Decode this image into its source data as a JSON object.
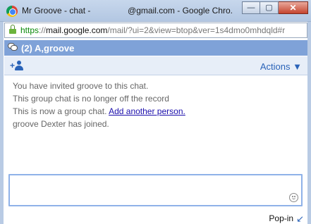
{
  "window": {
    "title_prefix": "Mr Groove - chat -",
    "title_suffix": "@gmail.com - Google Chro...",
    "minimize_glyph": "—",
    "maximize_glyph": "▢",
    "close_glyph": "✕"
  },
  "urlbar": {
    "scheme": "https",
    "separator": "://",
    "host": "mail.google.com",
    "path": "/mail/?ui=2&view=btop&ver=1s4dmo0mhdqld#r"
  },
  "chat": {
    "title": "(2) A,groove",
    "actions_label": "Actions ▼",
    "add_person_plus": "+"
  },
  "messages": [
    {
      "text": "You have invited groove to this chat."
    },
    {
      "text": "This group chat is no longer off the record"
    },
    {
      "text": "This is now a group chat.",
      "link": "Add another person."
    },
    {
      "text": "groove Dexter has joined."
    }
  ],
  "input": {
    "value": "",
    "placeholder": ""
  },
  "footer": {
    "popin_label": "Pop-in",
    "popin_arrow": "↙"
  },
  "colors": {
    "header_bg": "#7fa2d8",
    "link": "#1a0dab",
    "accent": "#2a63b8",
    "https_green": "#0a8a0a"
  }
}
